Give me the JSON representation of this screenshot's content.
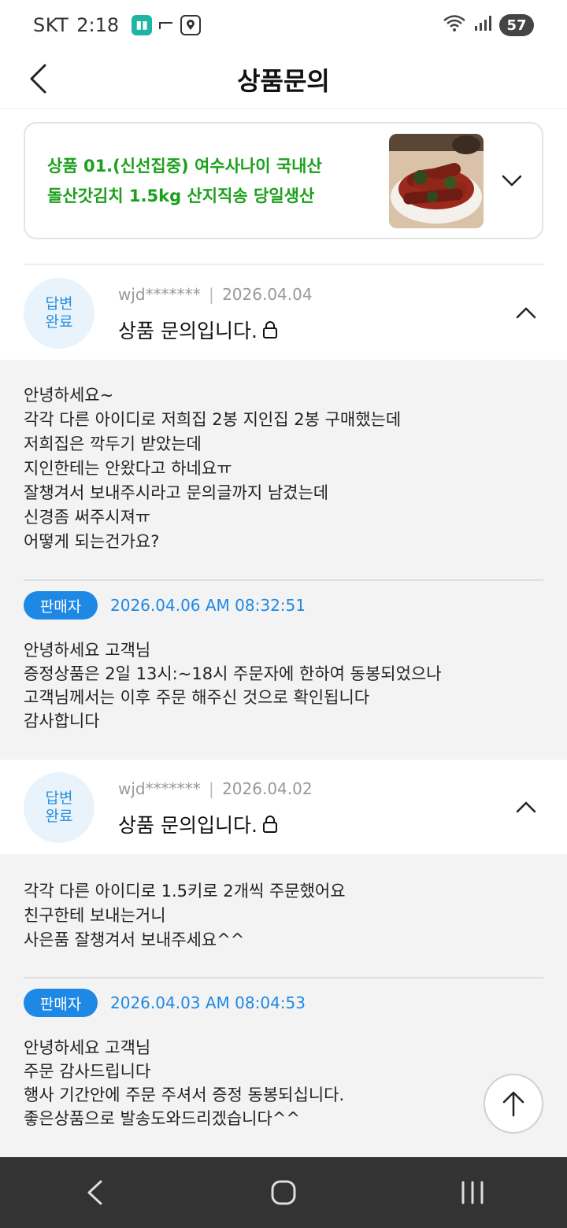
{
  "status_bar": {
    "carrier": "SKT",
    "time": "2:18",
    "battery": "57",
    "icons": [
      "app-icon",
      "screen-icon",
      "map-pin-icon",
      "wifi-icon",
      "signal-icon",
      "battery-icon"
    ]
  },
  "header": {
    "title": "상품문의",
    "back_icon": "chevron-left-icon"
  },
  "product": {
    "name_line1": "상품 01.(신선집중) 여수사나이 국내산",
    "name_line2": "돌산갓김치 1.5kg 산지직송 당일생산",
    "expand_icon": "chevron-down-icon"
  },
  "inquiries": [
    {
      "status_line1": "답변",
      "status_line2": "완료",
      "user": "wjd*******",
      "separator": "|",
      "date": "2026.04.04",
      "title": "상품 문의입니다.",
      "question": "안녕하세요~\n각각 다른 아이디로 저희집 2봉 지인집 2봉 구매했는데\n저희집은 깍두기 받았는데\n지인한테는 안왔다고 하네요ㅠ\n잘챙겨서 보내주시라고 문의글까지 남겼는데\n신경좀 써주시져ㅠ\n어떻게 되는건가요?",
      "seller_label": "판매자",
      "answer_time": "2026.04.06 AM 08:32:51",
      "answer": "안녕하세요 고객님\n증정상품은 2일 13시:~18시 주문자에 한하여 동봉되었으나\n고객님께서는 이후 주문 해주신 것으로 확인됩니다\n감사합니다"
    },
    {
      "status_line1": "답변",
      "status_line2": "완료",
      "user": "wjd*******",
      "separator": "|",
      "date": "2026.04.02",
      "title": "상품 문의입니다.",
      "question": "각각 다른 아이디로 1.5키로 2개씩 주문했어요\n친구한테 보내는거니\n사은품 잘챙겨서 보내주세요^^",
      "seller_label": "판매자",
      "answer_time": "2026.04.03 AM 08:04:53",
      "answer": "안녕하세요 고객님\n주문 감사드립니다\n행사 기간안에 주문 주셔서 증정 동봉되십니다.\n좋은상품으로 발송도와드리겠습니다^^"
    }
  ],
  "colors": {
    "product_green": "#1aa01a",
    "accent_blue": "#1e88e5",
    "status_circle_bg": "#e9f3fc",
    "body_gray": "#f3f3f3",
    "nav_bar": "#333333"
  }
}
